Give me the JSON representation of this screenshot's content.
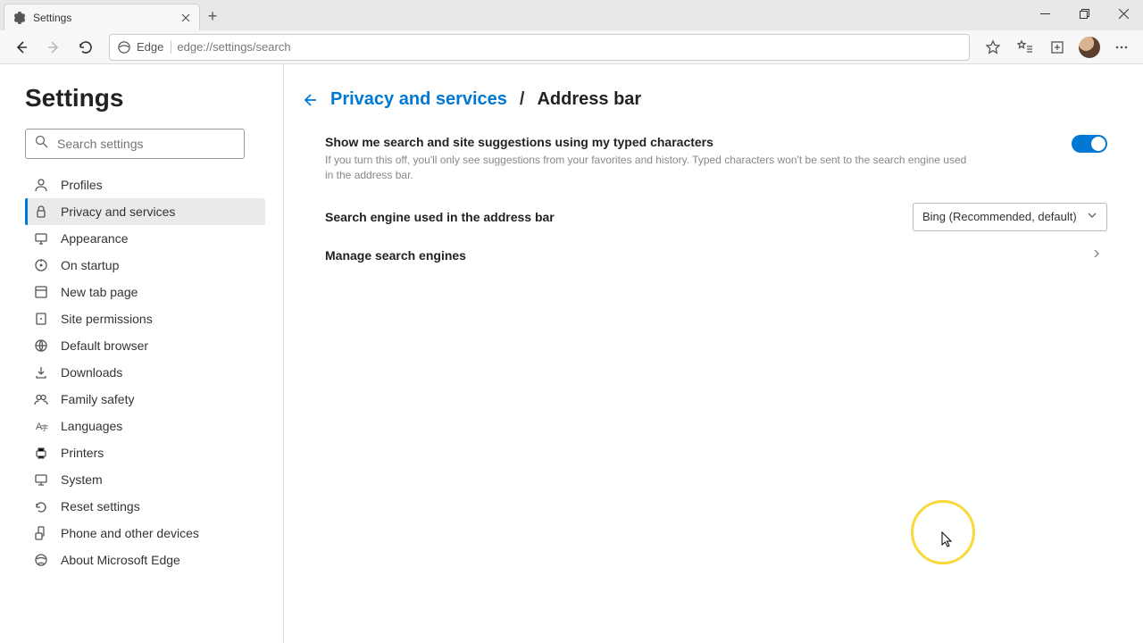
{
  "tab": {
    "title": "Settings"
  },
  "toolbar": {
    "site_name": "Edge",
    "url": "edge://settings/search"
  },
  "sidebar": {
    "title": "Settings",
    "search_placeholder": "Search settings",
    "items": [
      {
        "label": "Profiles"
      },
      {
        "label": "Privacy and services"
      },
      {
        "label": "Appearance"
      },
      {
        "label": "On startup"
      },
      {
        "label": "New tab page"
      },
      {
        "label": "Site permissions"
      },
      {
        "label": "Default browser"
      },
      {
        "label": "Downloads"
      },
      {
        "label": "Family safety"
      },
      {
        "label": "Languages"
      },
      {
        "label": "Printers"
      },
      {
        "label": "System"
      },
      {
        "label": "Reset settings"
      },
      {
        "label": "Phone and other devices"
      },
      {
        "label": "About Microsoft Edge"
      }
    ],
    "active_index": 1
  },
  "breadcrumb": {
    "parent": "Privacy and services",
    "sep": "/",
    "current": "Address bar"
  },
  "settings": {
    "suggestions": {
      "label": "Show me search and site suggestions using my typed characters",
      "desc": "If you turn this off, you'll only see suggestions from your favorites and history. Typed characters won't be sent to the search engine used in the address bar.",
      "enabled": true
    },
    "engine": {
      "label": "Search engine used in the address bar",
      "selected": "Bing (Recommended, default)"
    },
    "manage": {
      "label": "Manage search engines"
    }
  }
}
